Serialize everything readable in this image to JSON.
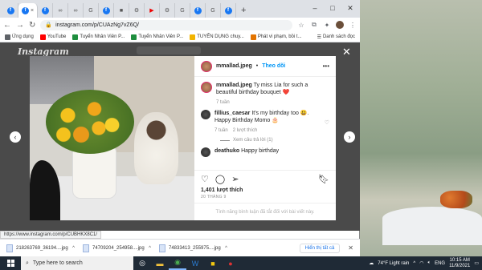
{
  "browser": {
    "tab_icons": [
      "f",
      "f",
      "f",
      "∞",
      "∞",
      "G",
      "f",
      "■",
      "⚙",
      "▶",
      "⚙",
      "G",
      "f",
      "G",
      "f"
    ],
    "new_tab": "+",
    "window_controls": [
      "–",
      "□",
      "✕"
    ],
    "url": "instagram.com/p/CUAzNg7vZ6Q/",
    "bookmarks": [
      {
        "label": "Ứng dụng",
        "color": "#5f6368"
      },
      {
        "label": "YouTube",
        "color": "#ff0000"
      },
      {
        "label": "Tuyển Nhân Viên P...",
        "color": "#1e8e3e"
      },
      {
        "label": "Tuyển Nhân Viên P...",
        "color": "#1e8e3e"
      },
      {
        "label": "TUYỂN DỤNG chuy...",
        "color": "#f2b400"
      },
      {
        "label": "Phát vi phạm, bồi t...",
        "color": "#e37400"
      }
    ],
    "reading_list": "Danh sách đọc"
  },
  "instagram": {
    "logo": "Instagram",
    "close": "✕",
    "post": {
      "username": "mmallad.jpeg",
      "follow": "Theo dõi",
      "more": "•••",
      "comments": [
        {
          "user": "mmallad.jpeg",
          "text": "Ty miss Lia for such a beautiful birthday bouquet ❤️",
          "time": "7 tuần",
          "likes": ""
        },
        {
          "user": "fillius_caesar",
          "text": "It's my birthday too 😃. Happy Birthday Momo 🎂",
          "time": "7 tuần",
          "likes": "2 lượt thích"
        },
        {
          "user": "deathuko",
          "text": "Happy birthday",
          "time": "",
          "likes": ""
        }
      ],
      "view_replies": "Xem câu trả lời (1)",
      "likes": "1,401 lượt thích",
      "date": "20 THÁNG 9",
      "comments_disabled": "Tính năng bình luận đã tắt đối với bài viết này."
    }
  },
  "status_url": "https://www.instagram.com/p/CUBHKX8C1/",
  "downloads": {
    "items": [
      "218263769_36194....jpg",
      "74709204_254958....jpg",
      "74833413_255975....jpg"
    ],
    "show_all": "Hiển thị tất cả"
  },
  "taskbar": {
    "search_placeholder": "Type here to search",
    "weather": "74°F  Light rain",
    "language": "ENG",
    "time": "10:15 AM",
    "date": "11/9/2021"
  }
}
